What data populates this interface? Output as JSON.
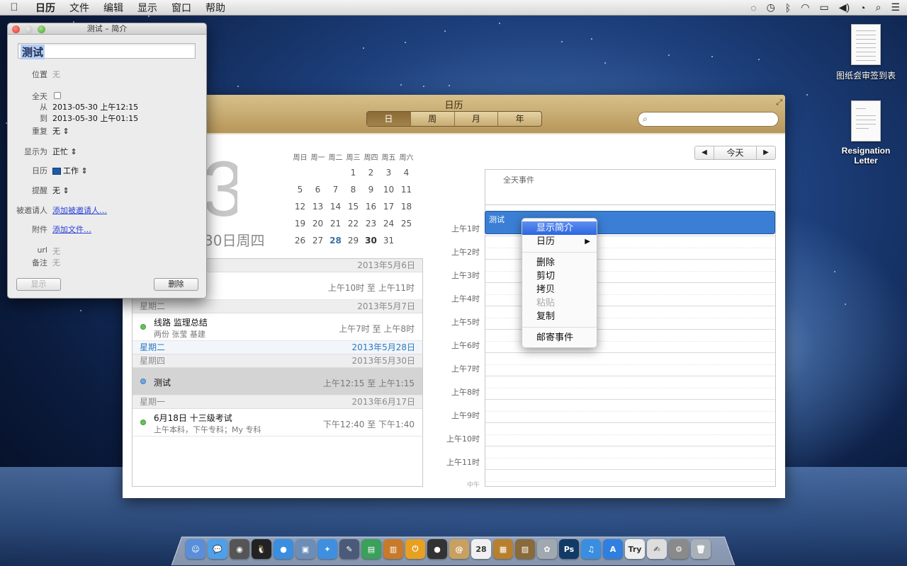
{
  "menubar": {
    "apple_icon": "apple-logo-icon",
    "items": [
      "日历",
      "文件",
      "编辑",
      "显示",
      "窗口",
      "帮助"
    ],
    "status_icons": [
      "chat-icon",
      "time-machine-icon",
      "bluetooth-icon",
      "wifi-icon",
      "battery-icon",
      "volume-icon",
      "clock-icon",
      "search-icon",
      "notification-list-icon"
    ]
  },
  "desktop": {
    "icons": [
      {
        "label": "图纸会审签到表"
      },
      {
        "label": "Resignation Letter"
      }
    ]
  },
  "calendar": {
    "window_title": "日历",
    "view_tabs": [
      "日",
      "周",
      "月",
      "年"
    ],
    "active_tab": "日",
    "search_placeholder": "",
    "big_day": "30",
    "big_date_text": "30日周四",
    "mini_calendar": {
      "weekday_headers": [
        "周日",
        "周一",
        "周二",
        "周三",
        "周四",
        "周五",
        "周六"
      ],
      "weeks": [
        [
          "",
          "",
          "",
          "1",
          "2",
          "3",
          "4"
        ],
        [
          "5",
          "6",
          "7",
          "8",
          "9",
          "10",
          "11"
        ],
        [
          "12",
          "13",
          "14",
          "15",
          "16",
          "17",
          "18"
        ],
        [
          "19",
          "20",
          "21",
          "22",
          "23",
          "24",
          "25"
        ],
        [
          "26",
          "27",
          "28",
          "29",
          "30",
          "31",
          ""
        ]
      ],
      "bold_days": [
        "30"
      ],
      "today": "28"
    },
    "nav": {
      "prev": "◀",
      "today": "今天",
      "next": "▶"
    },
    "event_list": {
      "top_header": {
        "day": "",
        "date": "2013年5月6日"
      },
      "top_row": {
        "title": "",
        "time": "上午10时 至 上午11时"
      },
      "groups": [
        {
          "day": "星期二",
          "date": "2013年5月7日",
          "highlight": false,
          "events": [
            {
              "title": "线路 监理总结",
              "subtitle": "两份 张莹 基建",
              "time": "上午7时 至 上午8时",
              "dot": "green",
              "selected": false
            }
          ]
        },
        {
          "day": "星期二",
          "date": "2013年5月28日",
          "highlight": true,
          "events": []
        },
        {
          "day": "星期四",
          "date": "2013年5月30日",
          "highlight": false,
          "events": [
            {
              "title": "测试",
              "subtitle": "",
              "time": "上午12:15 至 上午1:15",
              "dot": "blue",
              "selected": true
            }
          ]
        },
        {
          "day": "星期一",
          "date": "2013年6月17日",
          "highlight": false,
          "events": [
            {
              "title": "6月18日 十三级考试",
              "subtitle": "上午本科，下午专科；My 专科",
              "time": "下午12:40 至 下午1:40",
              "dot": "green",
              "selected": false
            }
          ]
        }
      ]
    },
    "day_view": {
      "allday_label": "全天事件",
      "hours": [
        "上午1时",
        "上午2时",
        "上午3时",
        "上午4时",
        "上午5时",
        "上午6时",
        "上午7时",
        "上午8时",
        "上午9时",
        "上午10时",
        "上午11时",
        "中午"
      ],
      "event_title": "测试",
      "event_color": "#3a7fd5"
    }
  },
  "context_menu": {
    "items": [
      {
        "label": "显示简介",
        "highlighted": true,
        "disabled": false,
        "submenu": false
      },
      {
        "label": "日历",
        "highlighted": false,
        "disabled": false,
        "submenu": true
      },
      {
        "sep": true
      },
      {
        "label": "删除",
        "highlighted": false,
        "disabled": false,
        "submenu": false
      },
      {
        "label": "剪切",
        "highlighted": false,
        "disabled": false,
        "submenu": false
      },
      {
        "label": "拷贝",
        "highlighted": false,
        "disabled": false,
        "submenu": false
      },
      {
        "label": "粘贴",
        "highlighted": false,
        "disabled": true,
        "submenu": false
      },
      {
        "label": "复制",
        "highlighted": false,
        "disabled": false,
        "submenu": false
      },
      {
        "sep": true
      },
      {
        "label": "邮寄事件",
        "highlighted": false,
        "disabled": false,
        "submenu": false
      }
    ]
  },
  "info_panel": {
    "window_title": "测试 – 简介",
    "event_title": "测试",
    "location_label": "位置",
    "location_value": "无",
    "allday_label": "全天",
    "from_label": "从",
    "from_value": "2013-05-30  上午12:15",
    "to_label": "到",
    "to_value": "2013-05-30  上午01:15",
    "repeat_label": "重复",
    "repeat_value": "无",
    "show_as_label": "显示为",
    "show_as_value": "正忙",
    "calendar_label": "日历",
    "calendar_value": "工作",
    "calendar_color": "#1e5aa8",
    "alert_label": "提醒",
    "alert_value": "无",
    "invitees_label": "被邀请人",
    "invitees_value": "添加被邀请人…",
    "attachments_label": "附件",
    "attachments_value": "添加文件…",
    "url_label": "url",
    "url_value": "无",
    "notes_label": "备注",
    "notes_value": "无",
    "show_button": "显示",
    "delete_button": "删除"
  },
  "dock": {
    "apps": [
      {
        "name": "finder-icon",
        "color": "#5a8fd8",
        "glyph": "☺"
      },
      {
        "name": "messages-icon",
        "color": "#4ea0e8",
        "glyph": "💬"
      },
      {
        "name": "facetime-icon",
        "color": "#555",
        "glyph": "◉"
      },
      {
        "name": "qq-icon",
        "color": "#222",
        "glyph": "🐧"
      },
      {
        "name": "qq-blue-icon",
        "color": "#3a8ee0",
        "glyph": "●"
      },
      {
        "name": "preview-icon",
        "color": "#6b8db8",
        "glyph": "▣"
      },
      {
        "name": "safari-icon",
        "color": "#3f8fe0",
        "glyph": "✦"
      },
      {
        "name": "sketch-icon",
        "color": "#4a5a78",
        "glyph": "✎"
      },
      {
        "name": "numbers-icon",
        "color": "#3aa05a",
        "glyph": "▤"
      },
      {
        "name": "keynote-icon",
        "color": "#c87a2a",
        "glyph": "▥"
      },
      {
        "name": "power-icon",
        "color": "#e8a020",
        "glyph": "⏻"
      },
      {
        "name": "dvd-icon",
        "color": "#333",
        "glyph": "●"
      },
      {
        "name": "contacts-icon",
        "color": "#c8a060",
        "glyph": "@"
      },
      {
        "name": "calendar-icon",
        "color": "#f0f0f0",
        "glyph": "28"
      },
      {
        "name": "package-icon",
        "color": "#b8802c",
        "glyph": "▦"
      },
      {
        "name": "photos-icon",
        "color": "#8a6a3a",
        "glyph": "▨"
      },
      {
        "name": "iphoto-icon",
        "color": "#a0a8b0",
        "glyph": "✿"
      },
      {
        "name": "photoshop-icon",
        "color": "#123a66",
        "glyph": "Ps"
      },
      {
        "name": "itunes-icon",
        "color": "#3a8ee0",
        "glyph": "♫"
      },
      {
        "name": "appstore-icon",
        "color": "#2f7fe0",
        "glyph": "A"
      },
      {
        "name": "stickies-icon",
        "color": "#eee",
        "glyph": "Try"
      },
      {
        "name": "textedit-icon",
        "color": "#ddd",
        "glyph": "✍"
      },
      {
        "name": "system-prefs-icon",
        "color": "#8a8a8a",
        "glyph": "⚙"
      },
      {
        "name": "trash-icon",
        "color": "#a8b0b8",
        "glyph": "🗑"
      }
    ]
  }
}
